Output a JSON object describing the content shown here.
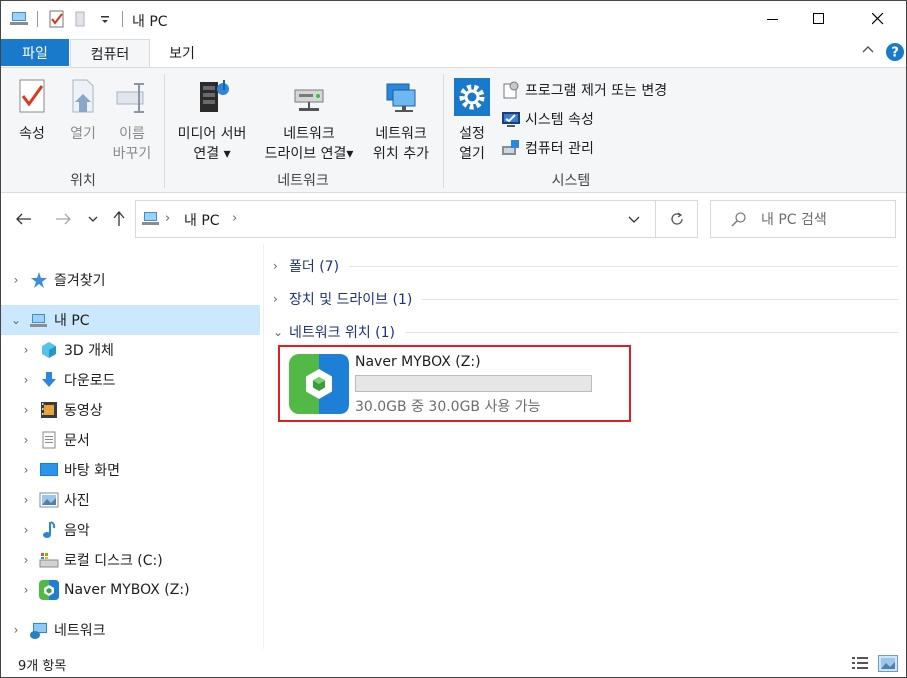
{
  "window": {
    "title": "내 PC"
  },
  "ribbon_tabs": {
    "file": "파일",
    "computer": "컴퓨터",
    "view": "보기"
  },
  "ribbon": {
    "location": {
      "label": "위치",
      "properties": "속성",
      "open": "열기",
      "rename_line1": "이름",
      "rename_line2": "바꾸기"
    },
    "network": {
      "label": "네트워크",
      "media_line1": "미디어 서버",
      "media_line2": "연결",
      "map_line1": "네트워크",
      "map_line2": "드라이브 연결",
      "add_line1": "네트워크",
      "add_line2": "위치 추가"
    },
    "system": {
      "label": "시스템",
      "settings_line1": "설정",
      "settings_line2": "열기",
      "uninstall": "프로그램 제거 또는 변경",
      "sysprops": "시스템 속성",
      "manage": "컴퓨터 관리"
    }
  },
  "address": {
    "path": "내 PC",
    "search_placeholder": "내 PC 검색"
  },
  "navpane": {
    "favorites": "즐겨찾기",
    "this_pc": "내 PC",
    "items": [
      "3D 개체",
      "다운로드",
      "동영상",
      "문서",
      "바탕 화면",
      "사진",
      "음악",
      "로컬 디스크 (C:)",
      "Naver MYBOX (Z:)"
    ],
    "network": "네트워크"
  },
  "content": {
    "folders": "폴더 (7)",
    "devices": "장치 및 드라이브 (1)",
    "netloc": "네트워크 위치 (1)",
    "drive": {
      "name": "Naver MYBOX (Z:)",
      "free_text": "30.0GB 중 30.0GB 사용 가능",
      "used_fraction": 0
    }
  },
  "status": {
    "count": "9개 항목"
  },
  "colors": {
    "accent": "#1979ca",
    "selection": "#cce8ff",
    "highlight_border": "#e02020",
    "section_text": "#1e3287"
  }
}
